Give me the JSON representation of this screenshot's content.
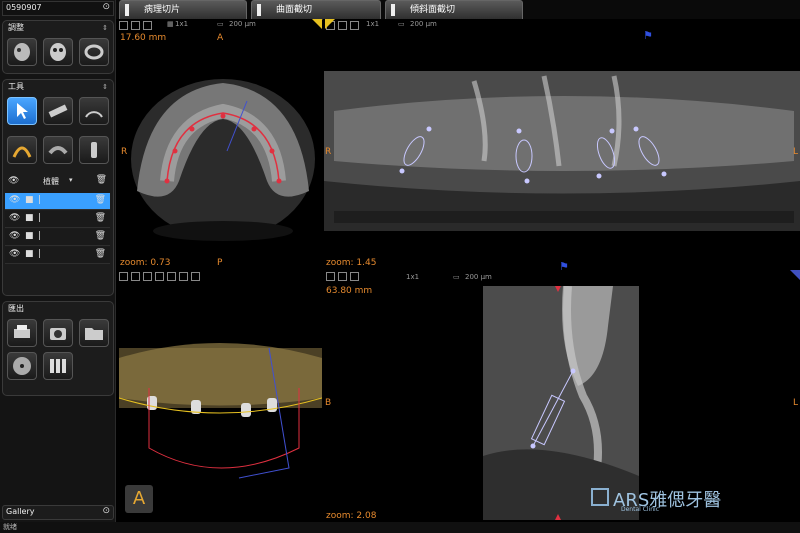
{
  "left_panel": {
    "id_field": "0590907",
    "adjust_title": "調整",
    "tools_title": "工具",
    "layers_header": "植體",
    "export_title": "匯出",
    "gallery_label": "Gallery"
  },
  "status_bar": "就绪",
  "tabs": [
    {
      "label": "病理切片"
    },
    {
      "label": "曲面截切"
    },
    {
      "label": "傾斜面截切"
    }
  ],
  "views": {
    "axial": {
      "distance": "17.60 mm",
      "orient_top": "A",
      "orient_left": "R",
      "orient_bottom": "P",
      "zoom": "zoom: 0.73",
      "grid": "1x1",
      "scale": "200 µm"
    },
    "panoramic": {
      "orient_left": "R",
      "orient_right": "L",
      "grid": "1x1",
      "scale": "200 µm"
    },
    "volume": {
      "badge": "A"
    },
    "cross": {
      "distance": "63.80 mm",
      "orient_left": "B",
      "orient_right": "L",
      "zoom_top": "zoom: 1.45",
      "zoom_bottom": "zoom: 2.08",
      "grid": "1x1",
      "scale": "200 µm"
    }
  },
  "watermark": {
    "text": "ARS雅偲牙醫",
    "sub": "Dental Clinic"
  }
}
